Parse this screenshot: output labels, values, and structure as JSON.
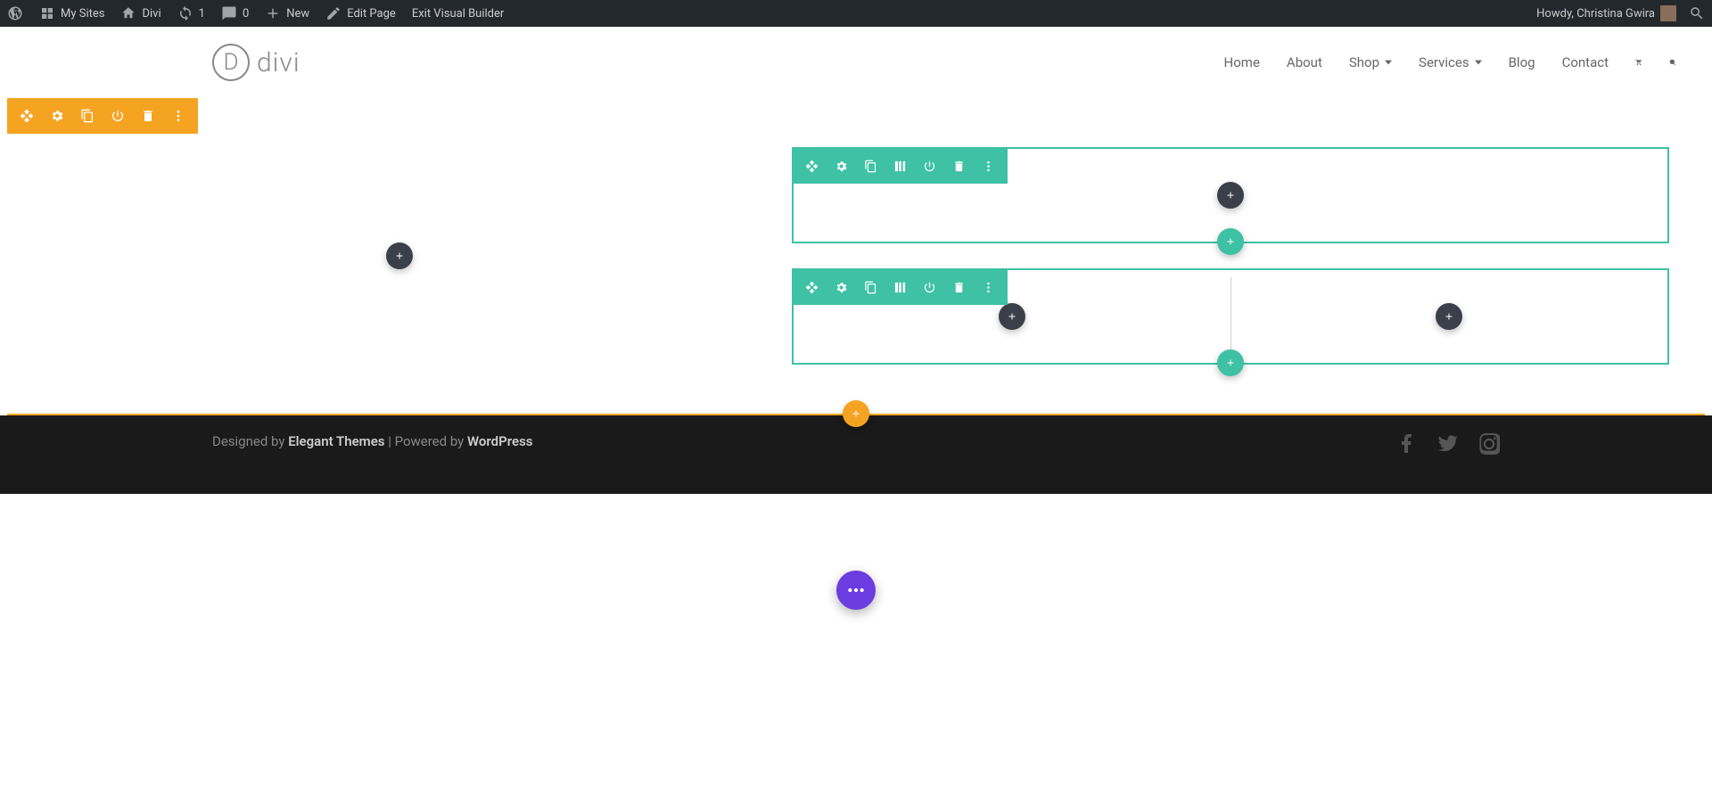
{
  "adminbar": {
    "my_sites": "My Sites",
    "site_name": "Divi",
    "updates": "1",
    "comments": "0",
    "new": "New",
    "edit_page": "Edit Page",
    "exit_builder": "Exit Visual Builder",
    "greeting": "Howdy, Christina Gwira"
  },
  "nav": {
    "logo_text": "divi",
    "home": "Home",
    "about": "About",
    "shop": "Shop",
    "services": "Services",
    "blog": "Blog",
    "contact": "Contact"
  },
  "footer": {
    "designed_by": "Designed by ",
    "et": "Elegant Themes",
    "powered_by": " | Powered by ",
    "wp": "WordPress"
  }
}
